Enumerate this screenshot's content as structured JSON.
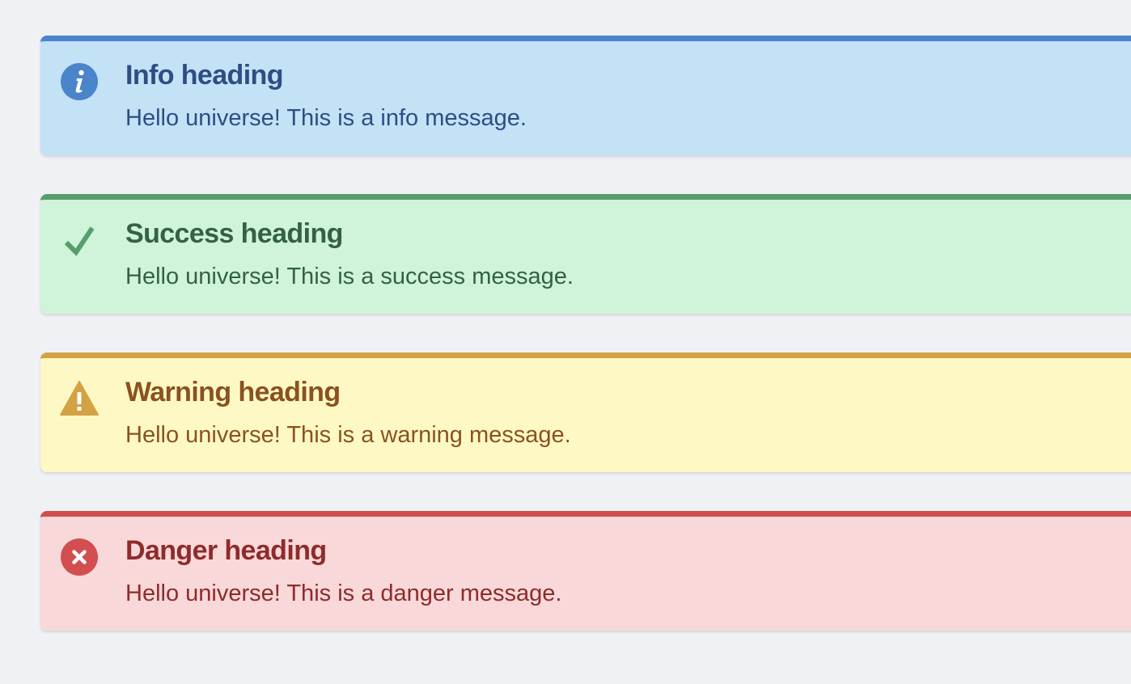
{
  "alerts": [
    {
      "type": "info",
      "icon": "info-circle-icon",
      "heading": "Info heading",
      "message": "Hello universe! This is a info message.",
      "colors": {
        "background": "#c3e2f6",
        "border": "#4a84cb",
        "text": "#2e4d84"
      }
    },
    {
      "type": "success",
      "icon": "checkmark-icon",
      "heading": "Success heading",
      "message": "Hello universe! This is a success message.",
      "colors": {
        "background": "#cff4da",
        "border": "#579d6d",
        "text": "#346145"
      }
    },
    {
      "type": "warning",
      "icon": "warning-triangle-icon",
      "heading": "Warning heading",
      "message": "Hello universe! This is a warning message.",
      "colors": {
        "background": "#fef9c4",
        "border": "#d3a245",
        "text": "#8a521f"
      }
    },
    {
      "type": "danger",
      "icon": "close-circle-icon",
      "heading": "Danger heading",
      "message": "Hello universe! This is a danger message.",
      "colors": {
        "background": "#f8d8d8",
        "border": "#d34e4e",
        "text": "#8f2b2b"
      }
    }
  ]
}
